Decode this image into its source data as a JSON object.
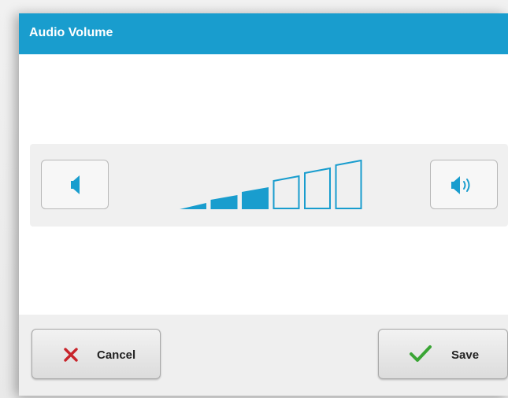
{
  "dialog": {
    "title": "Audio Volume"
  },
  "volume": {
    "level": 3,
    "max_level": 6,
    "accent_color": "#199dce",
    "decrease_icon": "speaker-icon",
    "increase_icon": "speaker-loud-icon"
  },
  "footer": {
    "cancel_label": "Cancel",
    "save_label": "Save",
    "cancel_icon": "x-icon",
    "save_icon": "checkmark-icon",
    "cancel_icon_color": "#c8242b",
    "save_icon_color": "#3aa535"
  },
  "colors": {
    "titlebar": "#199dce",
    "title_text": "#ffffff"
  }
}
